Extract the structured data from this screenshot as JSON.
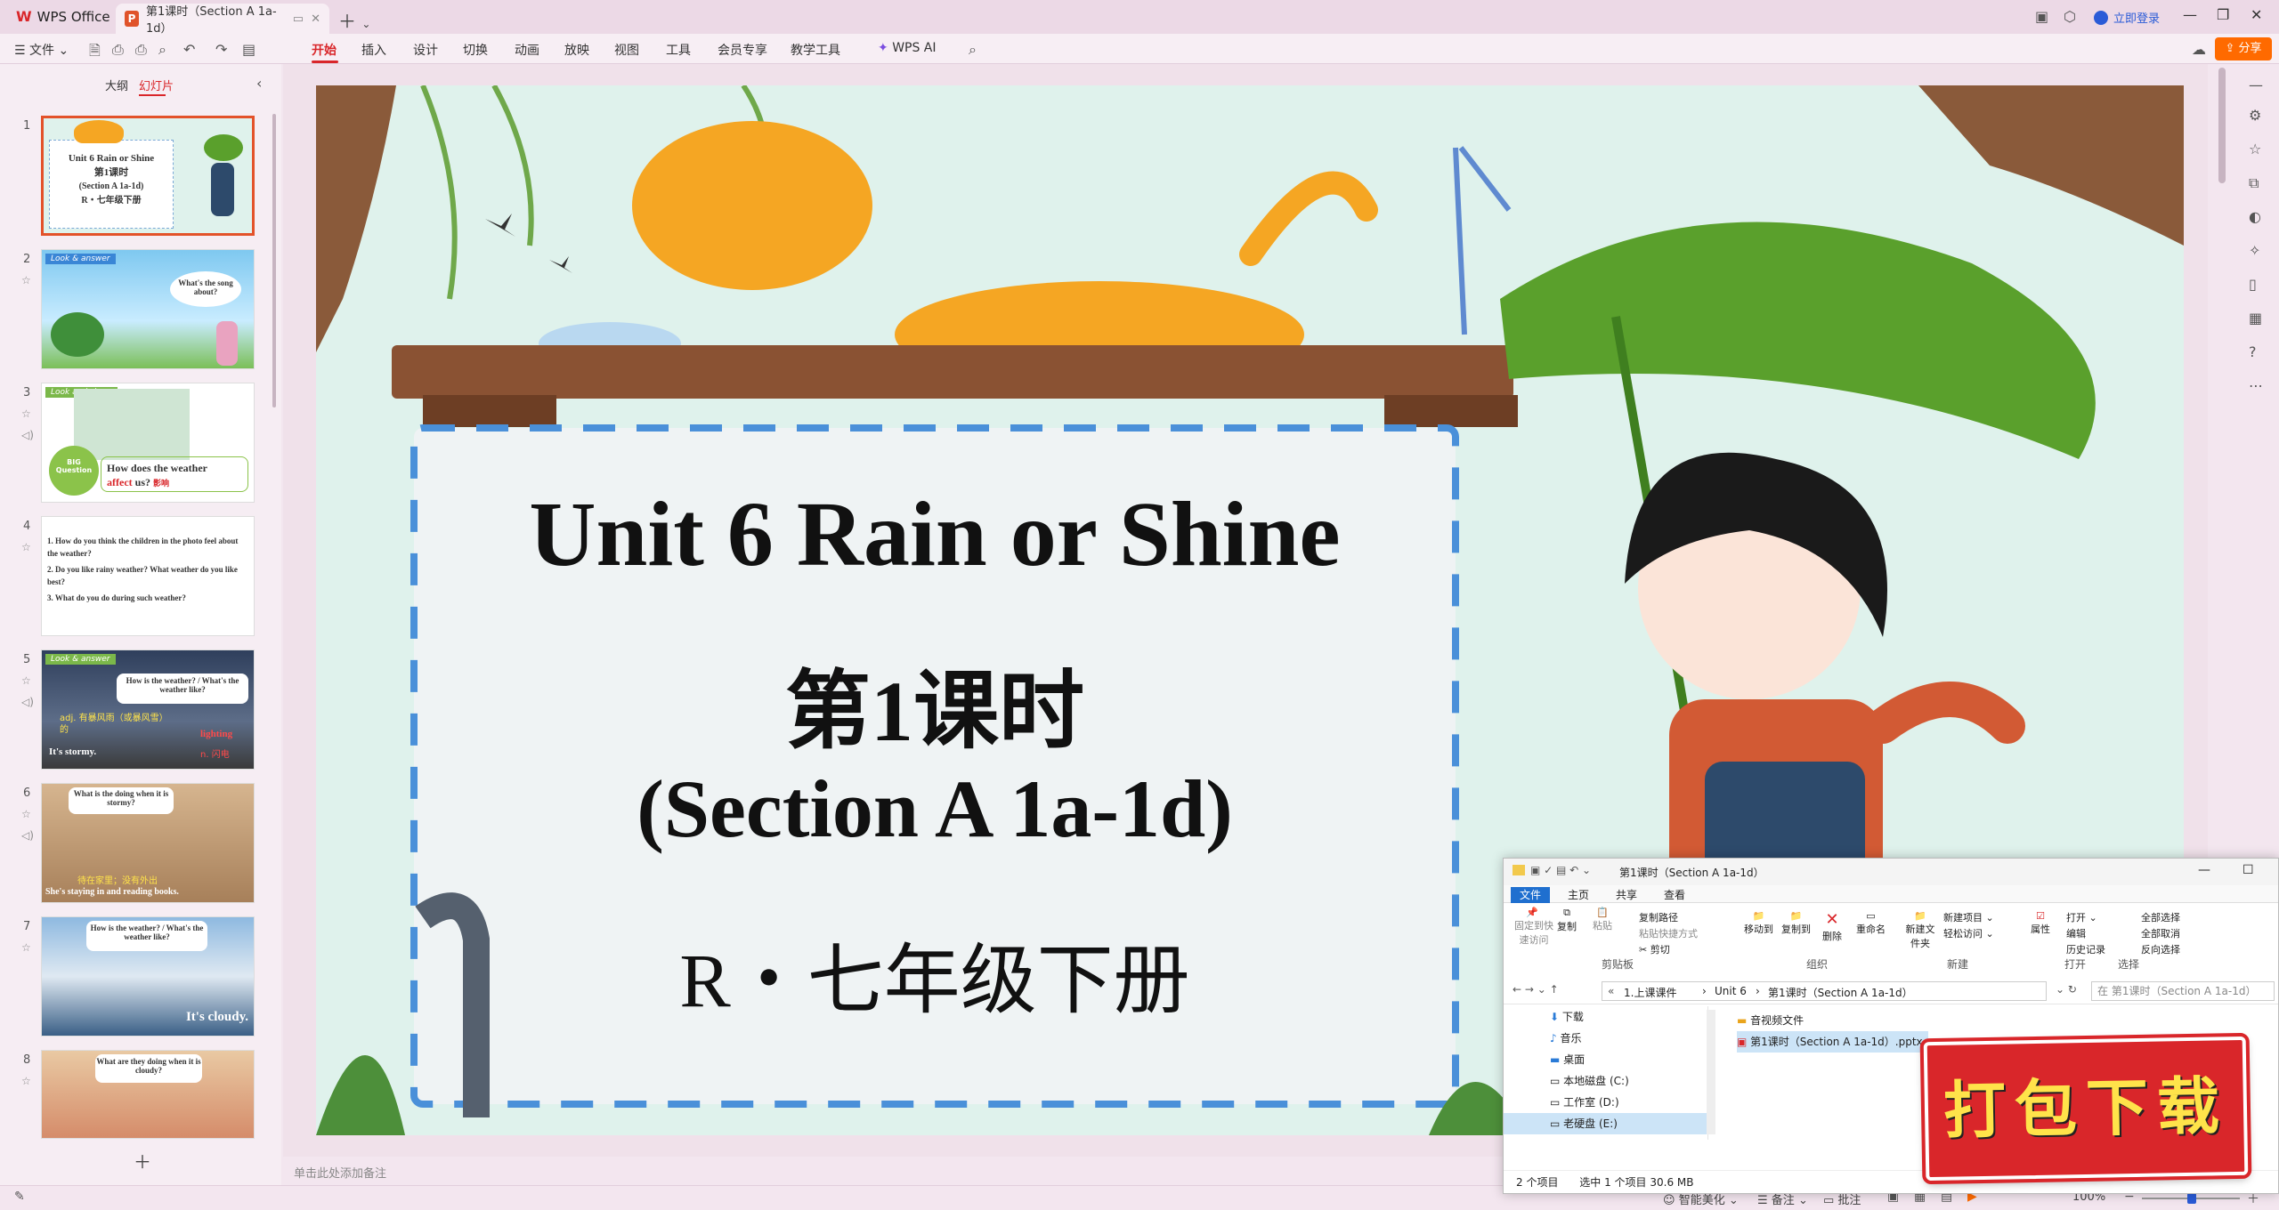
{
  "app": {
    "brand": "WPS Office",
    "doc_tab": "第1课时（Section A 1a-1d）",
    "login": "立即登录",
    "share": "分享"
  },
  "ribbon": {
    "file": "文件",
    "tabs": [
      "开始",
      "插入",
      "设计",
      "切换",
      "动画",
      "放映",
      "视图",
      "工具",
      "会员专享",
      "教学工具",
      "WPS AI"
    ]
  },
  "panel": {
    "outline": "大纲",
    "slides": "幻灯片"
  },
  "thumbs": [
    {
      "num": "1",
      "lines": [
        "Unit 6 Rain or Shine",
        "第1课时",
        "(Section A 1a-1d)",
        "R・七年级下册"
      ]
    },
    {
      "num": "2",
      "tag": "Look & answer",
      "bubble": "What's the song about?"
    },
    {
      "num": "3",
      "tag": "Look and share",
      "q": "How does the weather",
      "q2": "affect",
      "q3": "us?",
      "hint": "影响",
      "big": "BIG Question"
    },
    {
      "num": "4",
      "lines": [
        "1. How do you think the children in the photo feel about the weather?",
        "2. Do you like rainy weather? What weather do you like best?",
        "3. What do you do during such weather?"
      ]
    },
    {
      "num": "5",
      "tag": "Look & answer",
      "bubble": "How is the weather? / What's the weather like?",
      "adj": "adj. 有暴风雨（或暴风雪）的",
      "stormy": "It's stormy.",
      "lighting": "lighting",
      "lightn": "n. 闪电"
    },
    {
      "num": "6",
      "bubble": "What is the doing when it is stormy?",
      "sub": "待在家里；没有外出",
      "cap": "She's staying in and reading books."
    },
    {
      "num": "7",
      "bubble": "How is the weather? / What's the weather like?",
      "cap": "It's cloudy."
    },
    {
      "num": "8",
      "bubble": "What are they doing when it is cloudy?"
    }
  ],
  "slide": {
    "title": "Unit 6 Rain or Shine",
    "lesson": "第1课时",
    "section": "(Section A 1a-1d)",
    "grade": "R・七年级下册"
  },
  "notes_placeholder": "单击此处添加备注",
  "explorer": {
    "title": "第1课时（Section A 1a-1d）",
    "tabs": [
      "文件",
      "主页",
      "共享",
      "查看"
    ],
    "groups": [
      {
        "label": "剪贴板",
        "items": [
          "固定到快速访问",
          "复制",
          "粘贴",
          "复制路径",
          "粘贴快捷方式",
          "剪切"
        ]
      },
      {
        "label": "组织",
        "items": [
          "移动到",
          "复制到",
          "删除",
          "重命名"
        ]
      },
      {
        "label": "新建",
        "items": [
          "新建项目",
          "轻松访问",
          "新建文件夹"
        ]
      },
      {
        "label": "打开",
        "items": [
          "属性",
          "打开",
          "编辑",
          "历史记录"
        ]
      },
      {
        "label": "选择",
        "items": [
          "全部选择",
          "全部取消",
          "反向选择"
        ]
      }
    ],
    "path": [
      "1.上课课件",
      "Unit 6",
      "第1课时（Section A 1a-1d）"
    ],
    "search": "在 第1课时（Section A 1a-1d）",
    "tree": [
      "下载",
      "音乐",
      "桌面",
      "本地磁盘 (C:)",
      "工作室 (D:)",
      "老硬盘 (E:)"
    ],
    "files": [
      "音视频文件",
      "第1课时（Section A 1a-1d）.pptx"
    ],
    "status_count": "2 个项目",
    "status_sel": "选中 1 个项目  30.6 MB"
  },
  "stamp": "打包下载",
  "statusbar": {
    "beautify": "智能美化",
    "notes": "备注",
    "comment": "批注",
    "zoom": "100%"
  },
  "colors": {
    "accent": "#d9262a",
    "share": "#ff6a00",
    "selected_thumb": "#e3522a"
  }
}
